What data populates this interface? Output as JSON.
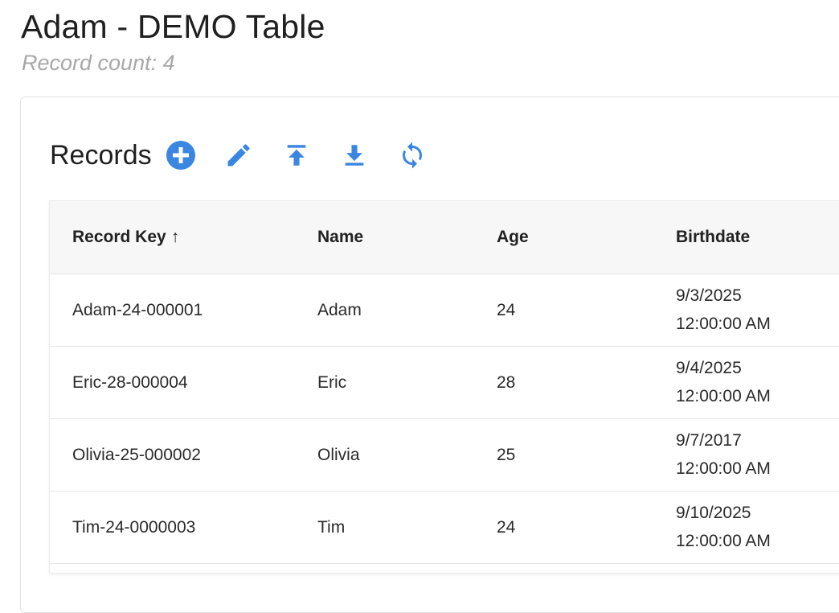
{
  "page": {
    "title": "Adam - DEMO Table",
    "record_count": "Record count: 4"
  },
  "records_section": {
    "title": "Records",
    "toolbar": [
      {
        "name": "add-record-button",
        "icon": "plus-circle-icon"
      },
      {
        "name": "edit-record-button",
        "icon": "pencil-icon"
      },
      {
        "name": "upload-button",
        "icon": "upload-icon"
      },
      {
        "name": "download-button",
        "icon": "download-icon"
      },
      {
        "name": "refresh-button",
        "icon": "refresh-icon"
      }
    ]
  },
  "colors": {
    "accent": "#3a86e0",
    "header_bg": "#f7f7f7",
    "muted_text": "#a8a8a8"
  },
  "table": {
    "columns": [
      {
        "label": "Record Key",
        "sort": "↑"
      },
      {
        "label": "Name"
      },
      {
        "label": "Age"
      },
      {
        "label": "Birthdate"
      }
    ],
    "rows": [
      {
        "key": "Adam-24-000001",
        "name": "Adam",
        "age": "24",
        "birth_date": "9/3/2025",
        "birth_time": "12:00:00 AM"
      },
      {
        "key": "Eric-28-000004",
        "name": "Eric",
        "age": "28",
        "birth_date": "9/4/2025",
        "birth_time": "12:00:00 AM"
      },
      {
        "key": "Olivia-25-000002",
        "name": "Olivia",
        "age": "25",
        "birth_date": "9/7/2017",
        "birth_time": "12:00:00 AM"
      },
      {
        "key": "Tim-24-0000003",
        "name": "Tim",
        "age": "24",
        "birth_date": "9/10/2025",
        "birth_time": "12:00:00 AM"
      }
    ]
  }
}
